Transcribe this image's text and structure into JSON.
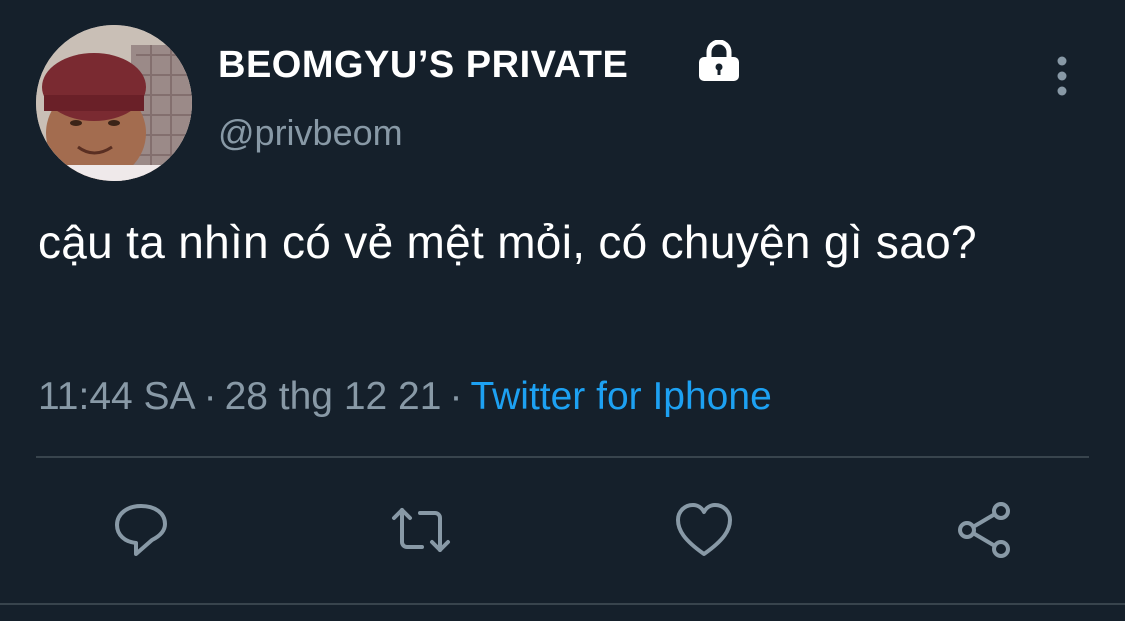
{
  "user": {
    "display_name": "BEOMGYU’S PRIVATE",
    "handle": "@privbeom",
    "protected_icon": "lock-icon",
    "avatar_icon": "avatar-photo"
  },
  "menu": {
    "icon": "more-vertical-icon"
  },
  "tweet": {
    "text": "cậu ta nhìn có vẻ mệt mỏi, có chuyện gì sao?",
    "time": "11:44 SA",
    "date": "28 thg 12 21",
    "separator": "·",
    "source": "Twitter for Iphone"
  },
  "actions": [
    {
      "name": "reply",
      "icon": "comment-icon"
    },
    {
      "name": "retweet",
      "icon": "retweet-icon"
    },
    {
      "name": "like",
      "icon": "heart-icon"
    },
    {
      "name": "share",
      "icon": "share-icon"
    }
  ],
  "colors": {
    "background": "#15202b",
    "primary_text": "#ffffff",
    "secondary_text": "#8899a6",
    "link": "#1da1f2",
    "divider": "#38444d"
  }
}
